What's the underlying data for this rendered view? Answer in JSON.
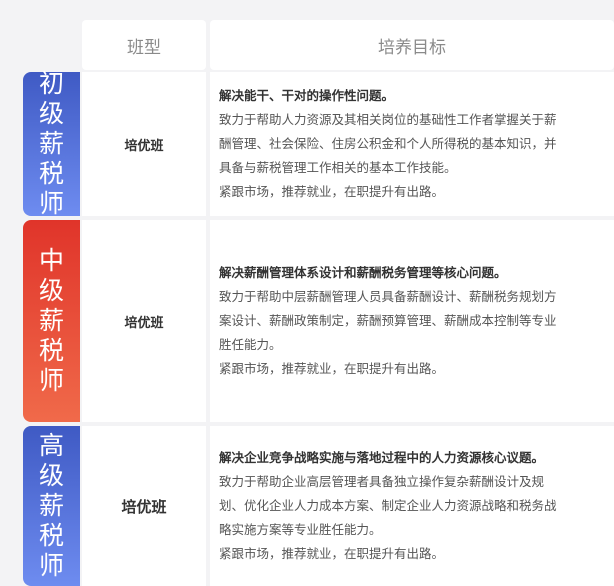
{
  "header": {
    "class_type": "班型",
    "goal": "培养目标"
  },
  "rows": [
    {
      "badge": [
        "初",
        "级",
        "薪",
        "税",
        "师"
      ],
      "class": "培优班",
      "goal_title": "解决能干、干对的操作性问题。",
      "goal_lines": [
        "致力于帮助人力资源及其相关岗位的基础性工作者掌握关于薪",
        "酬管理、社会保险、住房公积金和个人所得税的基本知识，并",
        "具备与薪税管理工作相关的基本工作技能。",
        "紧跟市场，推荐就业，在职提升有出路。"
      ]
    },
    {
      "badge": [
        "中",
        "级",
        "薪",
        "税",
        "师"
      ],
      "class": "培优班",
      "goal_title": "解决薪酬管理体系设计和薪酬税务管理等核心问题。",
      "goal_lines": [
        "致力于帮助中层薪酬管理人员具备薪酬设计、薪酬税务规划方",
        "案设计、薪酬政策制定，薪酬预算管理、薪酬成本控制等专业",
        "胜任能力。",
        "紧跟市场，推荐就业，在职提升有出路。"
      ]
    },
    {
      "badge": [
        "高",
        "级",
        "薪",
        "税",
        "师"
      ],
      "class": "培优班",
      "goal_title": "解决企业竞争战略实施与落地过程中的人力资源核心议题。",
      "goal_lines": [
        "致力于帮助企业高层管理者具备独立操作复杂薪酬设计及规",
        "划、优化企业人力成本方案、制定企业人力资源战略和税务战",
        "略实施方案等专业胜任能力。",
        "紧跟市场，推荐就业，在职提升有出路。"
      ]
    }
  ],
  "colors": {
    "blue_badge": "#4f6ad6",
    "red_badge": "#e84a38"
  }
}
